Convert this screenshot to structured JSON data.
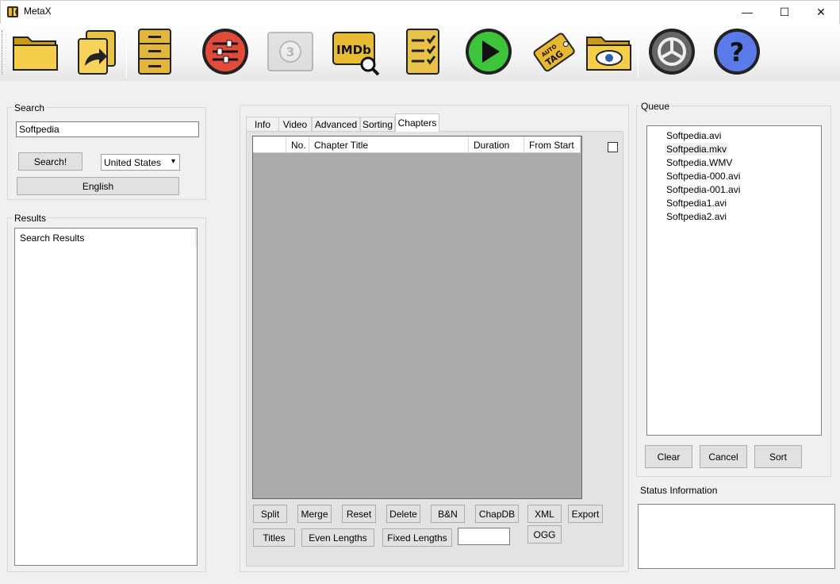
{
  "window": {
    "title": "MetaX",
    "minimize": "—",
    "maximize": "☐",
    "close": "✕"
  },
  "toolbar": {
    "items": [
      {
        "name": "open",
        "icon": "folder-open-icon"
      },
      {
        "name": "open-recent",
        "icon": "documents-arrow-icon"
      },
      {
        "name": "batch",
        "icon": "file-cabinet-icon"
      },
      {
        "name": "preferences",
        "icon": "sliders-icon"
      },
      {
        "name": "tv",
        "icon": "film-reel-icon"
      },
      {
        "name": "imdb",
        "icon": "imdb-search-icon",
        "label": "IMDb"
      },
      {
        "name": "checklist",
        "icon": "checklist-icon"
      },
      {
        "name": "process",
        "icon": "play-icon"
      },
      {
        "name": "auto-tag",
        "icon": "auto-tag-icon",
        "label_1": "AUTO",
        "label_2": "TAG"
      },
      {
        "name": "view-folder",
        "icon": "folder-eye-icon"
      },
      {
        "name": "settings",
        "icon": "settings-wheel-icon"
      },
      {
        "name": "help",
        "icon": "help-icon"
      }
    ]
  },
  "search": {
    "label": "Search",
    "query": "Softpedia",
    "search_button": "Search!",
    "country": "United States",
    "language_button": "English"
  },
  "results": {
    "label": "Results",
    "header": "Search Results"
  },
  "tabs": [
    {
      "label": "Info",
      "active": false
    },
    {
      "label": "Video",
      "active": false
    },
    {
      "label": "Advanced",
      "active": false
    },
    {
      "label": "Sorting",
      "active": false
    },
    {
      "label": "Chapters",
      "active": true
    }
  ],
  "chapters": {
    "columns": [
      "",
      "No.",
      "Chapter Title",
      "Duration",
      "From Start"
    ],
    "buttons_row1": [
      "Split",
      "Merge",
      "Reset",
      "Delete",
      "B&N",
      "ChapDB",
      "XML",
      "Export"
    ],
    "buttons_row2": [
      "Titles",
      "Even Lengths",
      "Fixed Lengths"
    ],
    "ogg_button": "OGG",
    "fixed_length_value": ""
  },
  "queue": {
    "label": "Queue",
    "items": [
      "Softpedia.avi",
      "Softpedia.mkv",
      "Softpedia.WMV",
      "Softpedia-000.avi",
      "Softpedia-001.avi",
      "Softpedia1.avi",
      "Softpedia2.avi"
    ],
    "clear": "Clear",
    "cancel": "Cancel",
    "sort": "Sort"
  },
  "status": {
    "label": "Status Information",
    "text": ""
  },
  "colors": {
    "grid_bg": "#ababab",
    "panel_bg": "#f0f0f0",
    "accent_gold": "#e8c24a"
  }
}
